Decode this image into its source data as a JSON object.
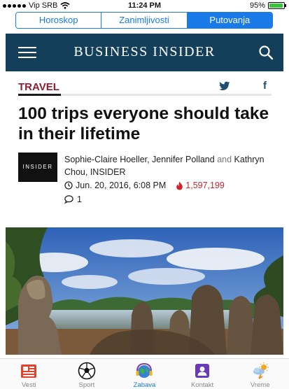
{
  "status_bar": {
    "carrier": "Vip SRB",
    "time": "11:24 PM",
    "battery": "95%",
    "battery_level": 0.95
  },
  "segments": {
    "items": [
      "Horoskop",
      "Zanimljivosti",
      "Putovanja"
    ],
    "selected": "Putovanja"
  },
  "header": {
    "brand": "BUSINESS INSIDER",
    "menu_icon": "hamburger-menu-icon",
    "search_icon": "search-icon"
  },
  "article": {
    "category": "TRAVEL",
    "share_icons": [
      "twitter-icon",
      "facebook-icon"
    ],
    "facebook_glyph": "f",
    "title": "100 trips everyone should take in their lifetime",
    "logo_text": "INSIDER",
    "authors_part1": "Sophie-Claire Hoeller, Jennifer Polland",
    "authors_and": "and",
    "authors_part2": "Kathryn Chou, INSIDER",
    "date": "Jun. 20, 2016, 6:08 PM",
    "views": "1,597,199",
    "comments": "1"
  },
  "colors": {
    "accent": "#1a7be8",
    "header_bg": "#143f5b",
    "category": "#8e1f2e",
    "views": "#d0252b"
  },
  "tabbar": {
    "items": [
      {
        "label": "Vesti",
        "icon": "newspaper-icon"
      },
      {
        "label": "Sport",
        "icon": "soccer-ball-icon"
      },
      {
        "label": "Zabava",
        "icon": "globe-headphones-icon"
      },
      {
        "label": "Kontakt",
        "icon": "contact-card-icon"
      },
      {
        "label": "Vreme",
        "icon": "weather-icon"
      }
    ],
    "selected": "Zabava"
  }
}
